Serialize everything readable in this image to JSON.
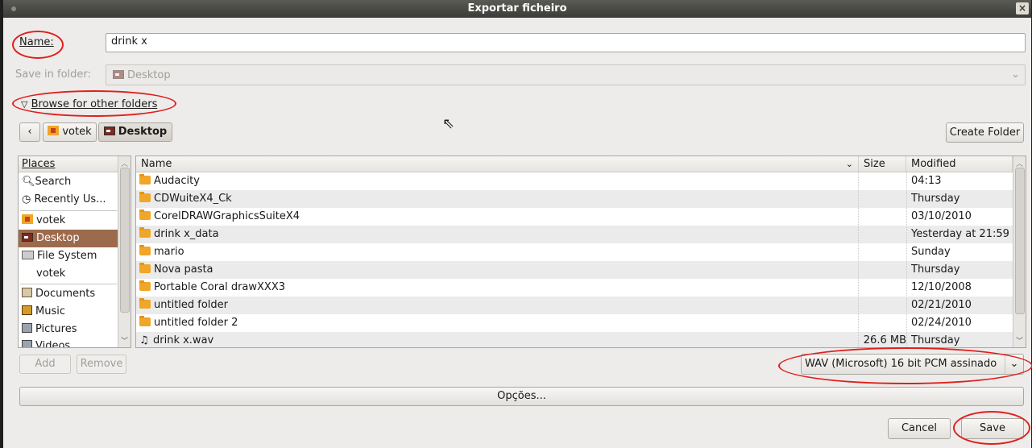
{
  "window": {
    "title": "Exportar ficheiro",
    "close_glyph": "×"
  },
  "name_field": {
    "label": "Name:",
    "value": "drink x"
  },
  "save_in": {
    "label": "Save in folder:",
    "value": "Desktop"
  },
  "browse": {
    "label": "Browse for other folders"
  },
  "path_bar": {
    "back_glyph": "‹",
    "crumbs": [
      "votek",
      "Desktop"
    ],
    "create_folder_label": "Create Folder"
  },
  "places": {
    "header": "Places",
    "items": [
      {
        "label": "Search",
        "icon": "search-icon"
      },
      {
        "label": "Recently Us...",
        "icon": "recent-icon"
      },
      {
        "label": "votek",
        "icon": "home-folder-icon"
      },
      {
        "label": "Desktop",
        "icon": "desktop-icon",
        "selected": true
      },
      {
        "label": "File System",
        "icon": "drive-icon"
      },
      {
        "label": "votek",
        "icon": "none"
      },
      {
        "label": "Documents",
        "icon": "documents-icon"
      },
      {
        "label": "Music",
        "icon": "music-icon"
      },
      {
        "label": "Pictures",
        "icon": "pictures-icon"
      },
      {
        "label": "Videos",
        "icon": "videos-icon"
      }
    ],
    "add_label": "Add",
    "remove_label": "Remove"
  },
  "files": {
    "columns": {
      "name": "Name",
      "size": "Size",
      "modified": "Modified"
    },
    "rows": [
      {
        "name": "Audacity",
        "size": "",
        "modified": "04:13",
        "type": "folder"
      },
      {
        "name": "CDWuiteX4_Ck",
        "size": "",
        "modified": "Thursday",
        "type": "folder"
      },
      {
        "name": "CorelDRAWGraphicsSuiteX4",
        "size": "",
        "modified": "03/10/2010",
        "type": "folder"
      },
      {
        "name": "drink x_data",
        "size": "",
        "modified": "Yesterday at 21:59",
        "type": "folder"
      },
      {
        "name": "mario",
        "size": "",
        "modified": "Sunday",
        "type": "folder"
      },
      {
        "name": "Nova pasta",
        "size": "",
        "modified": "Thursday",
        "type": "folder"
      },
      {
        "name": "Portable Coral drawXXX3",
        "size": "",
        "modified": "12/10/2008",
        "type": "folder"
      },
      {
        "name": "untitled folder",
        "size": "",
        "modified": "02/21/2010",
        "type": "folder"
      },
      {
        "name": "untitled folder 2",
        "size": "",
        "modified": "02/24/2010",
        "type": "folder"
      },
      {
        "name": "drink x.wav",
        "size": "26.6 MB",
        "modified": "Thursday",
        "type": "audio"
      }
    ]
  },
  "file_type": {
    "value": "WAV (Microsoft) 16 bit PCM assinado"
  },
  "options": {
    "label": "Opções..."
  },
  "actions": {
    "cancel_label": "Cancel",
    "save_label": "Save"
  },
  "colors": {
    "selection": "#9c6b4e",
    "annotation_red": "#e0201c",
    "titlebar": "#3c3b37",
    "folder": "#f0a628"
  }
}
